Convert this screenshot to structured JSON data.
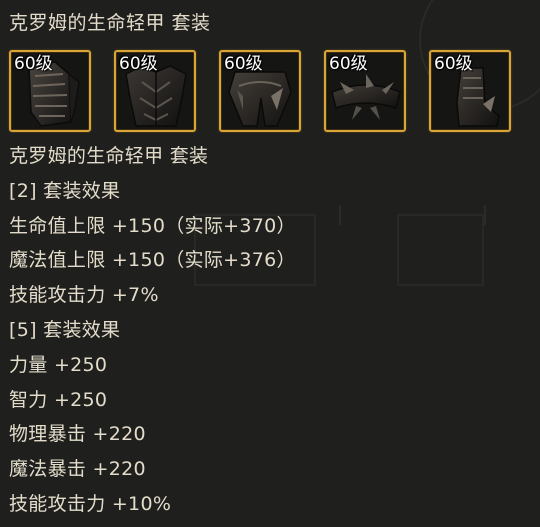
{
  "set_title": "克罗姆的生命轻甲 套装",
  "items": [
    {
      "level": "60级",
      "icon": "shoulder-armor-icon"
    },
    {
      "level": "60级",
      "icon": "chest-armor-icon"
    },
    {
      "level": "60级",
      "icon": "leg-armor-icon"
    },
    {
      "level": "60级",
      "icon": "belt-armor-icon"
    },
    {
      "level": "60级",
      "icon": "boots-armor-icon"
    }
  ],
  "details": [
    "克罗姆的生命轻甲 套装",
    "[2] 套装效果",
    "生命值上限 +150（实际+370）",
    "魔法值上限 +150（实际+376）",
    "技能攻击力 +7%",
    "[5] 套装效果",
    "力量 +250",
    "智力 +250",
    "物理暴击 +220",
    "魔法暴击 +220",
    "技能攻击力 +10%"
  ],
  "colors": {
    "background": "#1f1f1d",
    "text": "#e3dccb",
    "slot_border": "#d8a536"
  }
}
